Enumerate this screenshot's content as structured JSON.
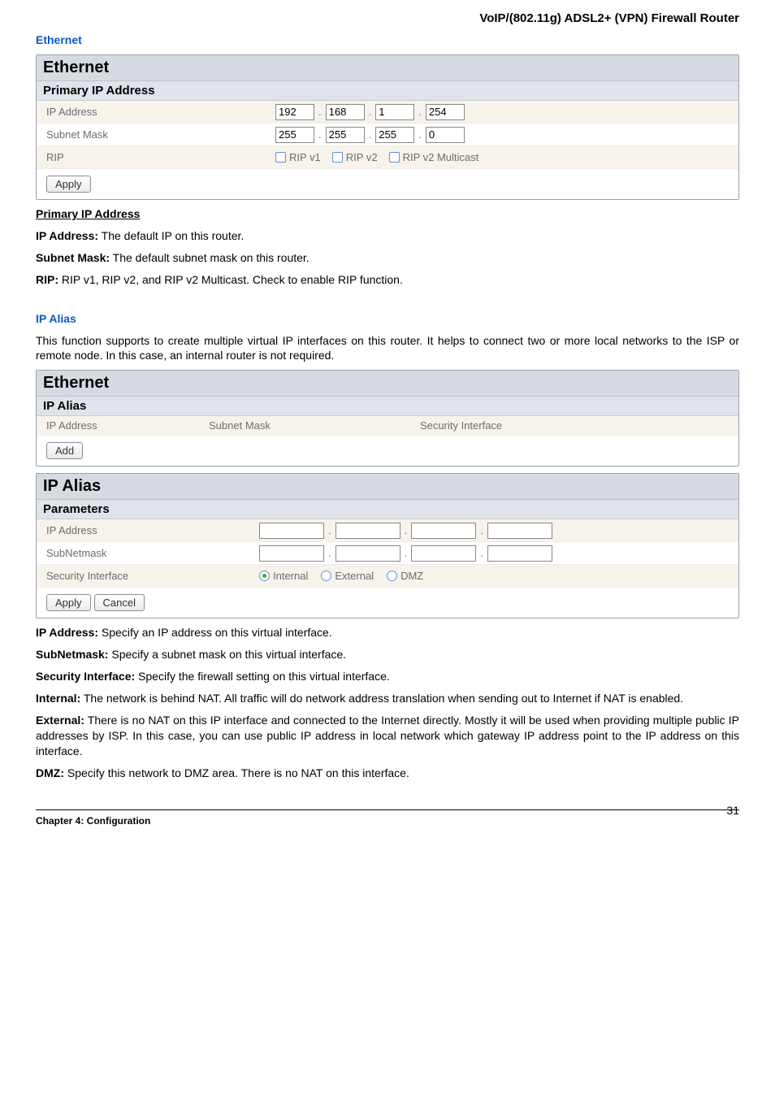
{
  "page": {
    "header": "VoIP/(802.11g) ADSL2+ (VPN) Firewall Router",
    "section_ethernet": "Ethernet",
    "section_ipalias": "IP Alias",
    "footer_chapter": "Chapter 4: Configuration",
    "footer_page": "31"
  },
  "ethernet_panel": {
    "title": "Ethernet",
    "subtitle": "Primary IP Address",
    "rows": {
      "ip_label": "IP Address",
      "ip": [
        "192",
        "168",
        "1",
        "254"
      ],
      "mask_label": "Subnet Mask",
      "mask": [
        "255",
        "255",
        "255",
        "0"
      ],
      "rip_label": "RIP",
      "rip_opts": [
        "RIP v1",
        "RIP v2",
        "RIP v2 Multicast"
      ]
    },
    "apply": "Apply"
  },
  "primary_text": {
    "heading": "Primary IP Address",
    "ipaddr_b": "IP Address:",
    "ipaddr_t": " The default IP on this router.",
    "mask_b": "Subnet Mask:",
    "mask_t": " The default subnet mask on this router.",
    "rip_b": "RIP:",
    "rip_t": " RIP v1, RIP v2, and RIP v2 Multicast.    Check to enable RIP function."
  },
  "ipalias_intro": "This function supports to create multiple virtual IP interfaces on this router. It helps to connect two or more local networks to the ISP or remote node. In this case, an internal router is not required.",
  "alias_list_panel": {
    "title": "Ethernet",
    "subtitle": "IP Alias",
    "cols": [
      "IP Address",
      "Subnet Mask",
      "Security Interface"
    ],
    "add": "Add"
  },
  "alias_form_panel": {
    "title": "IP Alias",
    "subtitle": "Parameters",
    "rows": {
      "ip_label": "IP Address",
      "snm_label": "SubNetmask",
      "sec_label": "Security Interface",
      "sec_opts": [
        "Internal",
        "External",
        "DMZ"
      ]
    },
    "apply": "Apply",
    "cancel": "Cancel"
  },
  "alias_text": {
    "ip_b": "IP Address:",
    "ip_t": " Specify an IP address on this virtual interface.",
    "snm_b": "SubNetmask:",
    "snm_t": " Specify a subnet mask on this virtual interface.",
    "sec_b": "Security Interface:",
    "sec_t": " Specify the firewall setting on this virtual interface.",
    "int_b": "Internal:",
    "int_t": " The network is behind NAT. All traffic will do network address translation when sending out to Internet if NAT is enabled.",
    "ext_b": "External:",
    "ext_t": " There is no NAT on this IP interface and connected to the Internet directly. Mostly it will be used when providing multiple public IP addresses by ISP. In this case, you can use public IP address in local network which gateway IP address point to the IP address on this interface.",
    "dmz_b": "DMZ:",
    "dmz_t": " Specify this network to DMZ area. There is no NAT on this interface."
  }
}
